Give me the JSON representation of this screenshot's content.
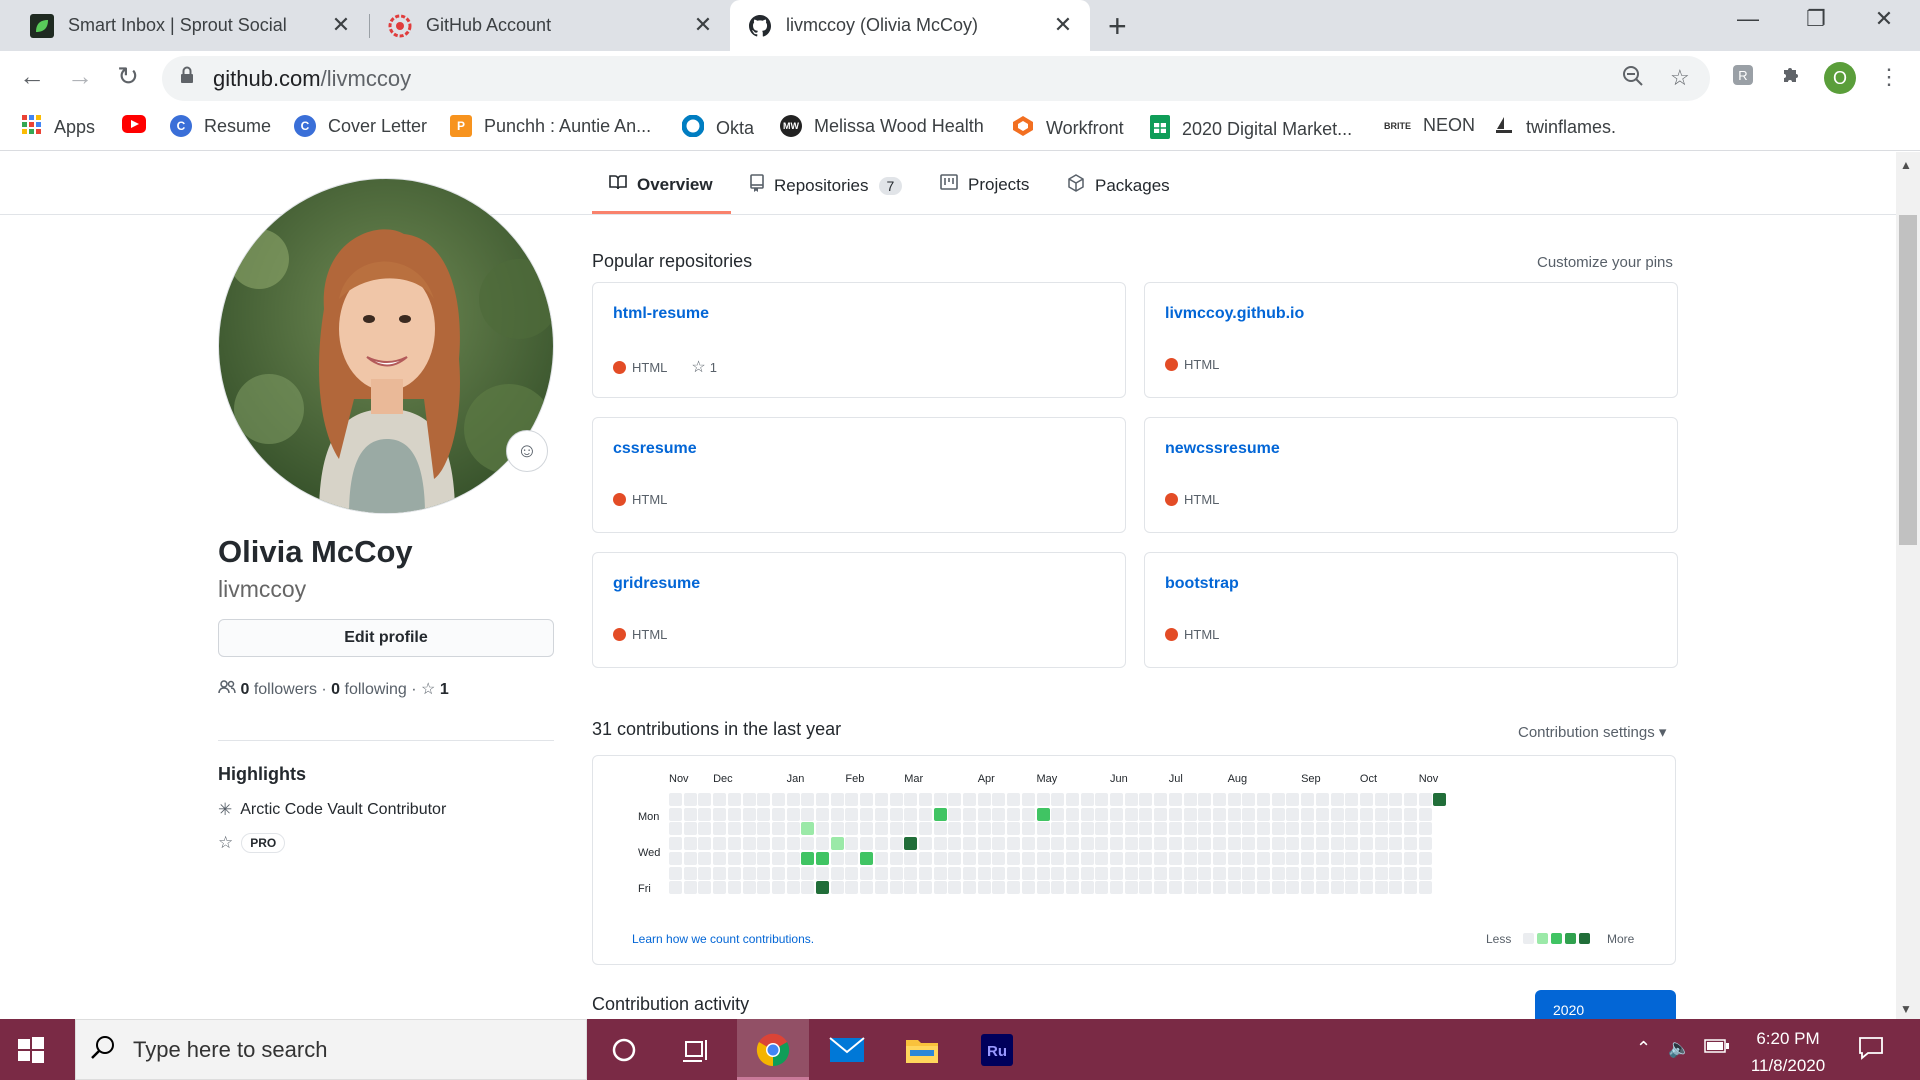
{
  "browser": {
    "tabs": [
      {
        "title": "Smart Inbox | Sprout Social",
        "icon": "sprout-leaf-icon"
      },
      {
        "title": "GitHub Account",
        "icon": "cloud-gear-icon"
      },
      {
        "title": "livmccoy (Olivia McCoy)",
        "icon": "github-icon"
      }
    ],
    "url_host": "github.com",
    "url_path": "/livmccoy",
    "profile_initial": "O",
    "bookmarks": [
      {
        "label": "Apps",
        "icon": "apps-grid-icon"
      },
      {
        "label": "",
        "icon": "youtube-icon"
      },
      {
        "label": "Resume",
        "icon": "c-logo-icon"
      },
      {
        "label": "Cover Letter",
        "icon": "c-logo-icon"
      },
      {
        "label": "Punchh : Auntie An...",
        "icon": "punchh-icon"
      },
      {
        "label": "Okta",
        "icon": "okta-icon"
      },
      {
        "label": "Melissa Wood Health",
        "icon": "mw-icon"
      },
      {
        "label": "Workfront",
        "icon": "workfront-icon"
      },
      {
        "label": "2020 Digital Market...",
        "icon": "sheets-icon"
      },
      {
        "label": "NEON",
        "icon": "brite-icon"
      },
      {
        "label": "twinflames.",
        "icon": "boat-icon"
      }
    ]
  },
  "github": {
    "nav": {
      "overview": "Overview",
      "repositories": "Repositories",
      "repo_count": "7",
      "projects": "Projects",
      "packages": "Packages"
    },
    "profile": {
      "name": "Olivia McCoy",
      "username": "livmccoy",
      "edit_label": "Edit profile",
      "followers": "0",
      "followers_label": "followers",
      "following": "0",
      "following_label": "following",
      "stars": "1",
      "highlights_title": "Highlights",
      "highlight_vault": "Arctic Code Vault Contributor",
      "highlight_pro": "PRO"
    },
    "popular": {
      "title": "Popular repositories",
      "customize": "Customize your pins",
      "repos": [
        {
          "name": "html-resume",
          "lang": "HTML",
          "stars": "1"
        },
        {
          "name": "livmccoy.github.io",
          "lang": "HTML",
          "stars": ""
        },
        {
          "name": "cssresume",
          "lang": "HTML",
          "stars": ""
        },
        {
          "name": "newcssresume",
          "lang": "HTML",
          "stars": ""
        },
        {
          "name": "gridresume",
          "lang": "HTML",
          "stars": ""
        },
        {
          "name": "bootstrap",
          "lang": "HTML",
          "stars": ""
        }
      ]
    },
    "contributions": {
      "title": "31 contributions in the last year",
      "settings": "Contribution settings ▾",
      "months": [
        "Nov",
        "Dec",
        "Jan",
        "Feb",
        "Mar",
        "Apr",
        "May",
        "Jun",
        "Jul",
        "Aug",
        "Sep",
        "Oct",
        "Nov"
      ],
      "days": [
        "Mon",
        "Wed",
        "Fri"
      ],
      "learn": "Learn how we count contributions.",
      "less": "Less",
      "more": "More",
      "colors": [
        "#ebedf0",
        "#9be9a8",
        "#40c463",
        "#30a14e",
        "#216e39"
      ],
      "active_cells": [
        {
          "week": 9,
          "day": 2,
          "level": 1
        },
        {
          "week": 9,
          "day": 4,
          "level": 2
        },
        {
          "week": 10,
          "day": 4,
          "level": 2
        },
        {
          "week": 10,
          "day": 6,
          "level": 4
        },
        {
          "week": 11,
          "day": 3,
          "level": 1
        },
        {
          "week": 13,
          "day": 4,
          "level": 2
        },
        {
          "week": 16,
          "day": 3,
          "level": 4
        },
        {
          "week": 18,
          "day": 1,
          "level": 2
        },
        {
          "week": 25,
          "day": 1,
          "level": 2
        },
        {
          "week": 52,
          "day": 0,
          "level": 4
        }
      ]
    },
    "activity_title": "Contribution activity",
    "year": "2020"
  },
  "taskbar": {
    "search_placeholder": "Type here to search",
    "time": "6:20 PM",
    "date": "11/8/2020"
  }
}
